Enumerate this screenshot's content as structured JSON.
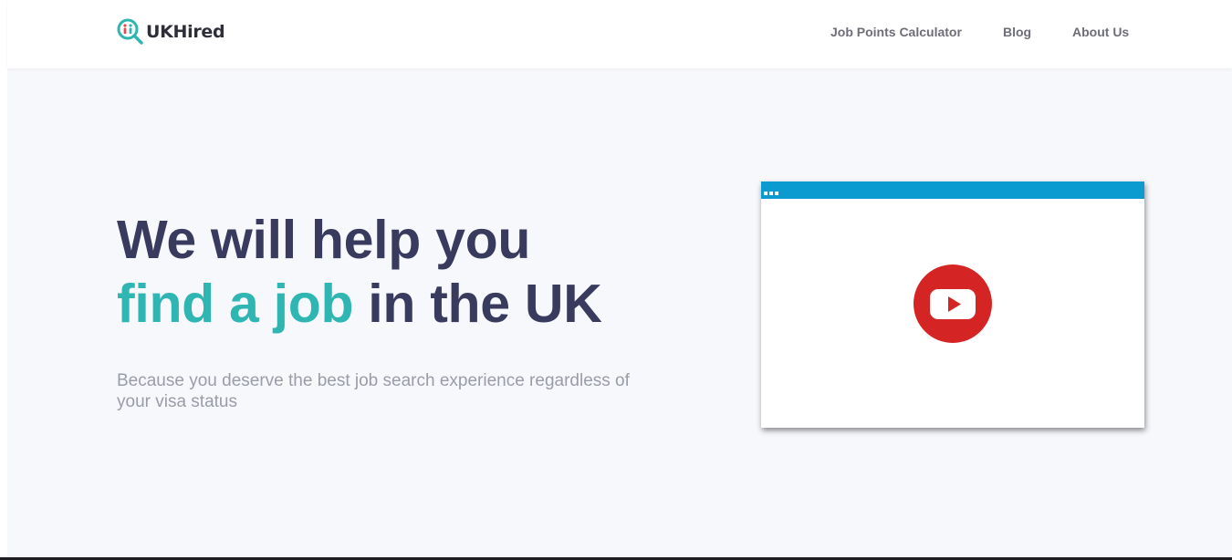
{
  "header": {
    "logo": {
      "text": "UKHired",
      "icon": "magnifier-person-logo-icon",
      "mark_color": "#2fb6b2",
      "person_color": "#e5484d"
    },
    "nav": [
      {
        "label": "Job Points Calculator"
      },
      {
        "label": "Blog"
      },
      {
        "label": "About Us"
      }
    ]
  },
  "hero": {
    "headline": {
      "line1": "We will help you",
      "line2_accent": "find a job",
      "line2_rest": " in the UK"
    },
    "subtitle": "Because you deserve the best job search experience regardless of your visa status"
  },
  "video": {
    "play_icon": "youtube-play-icon",
    "window_dots_icon": "window-dots-icon"
  },
  "colors": {
    "heading": "#383a5e",
    "accent": "#2fb6b2",
    "subtitle": "#9a9ca8",
    "nav_text": "#6e6e78",
    "hero_background": "#f7f8fc",
    "video_bar": "#0b9bd0",
    "play_red": "#d42524"
  }
}
